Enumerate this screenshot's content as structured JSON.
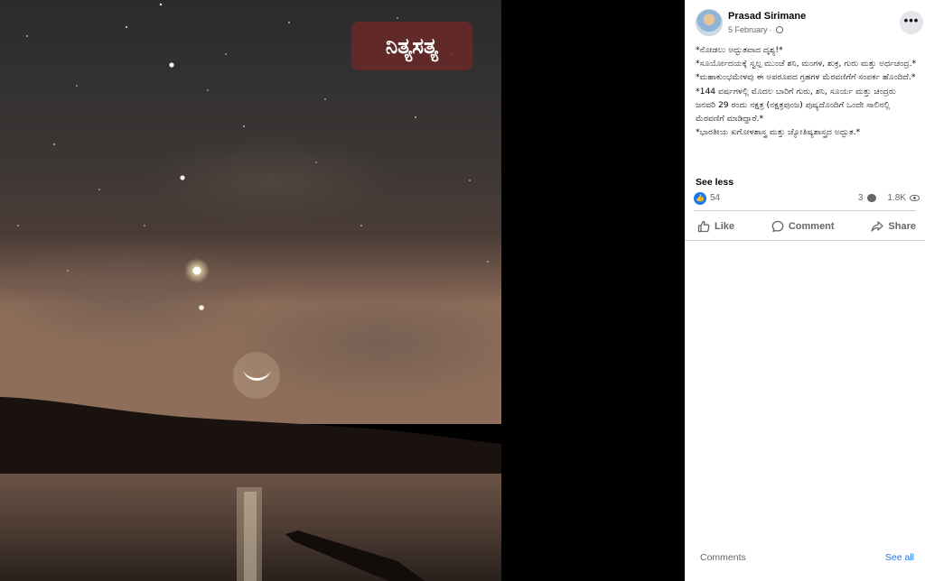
{
  "photo": {
    "watermark": "ನಿತ್ಯಸತ್ಯ"
  },
  "post": {
    "author": "Prasad Sirimane",
    "date": "5 February",
    "caption_lines": [
      "*ನೋಡಲು ಅದ್ಭುತವಾದ ದೃಶ್ಯ!*",
      "*ಸೂರ್ಯೋದಯಕ್ಕೆ ಸ್ವಲ್ಪ ಮುಂಚೆ ಶನಿ, ಮಂಗಳ, ಶುಕ್ರ, ಗುರು ಮತ್ತು ಅರ್ಧಚಂದ್ರ.*",
      "*ಮಹಾಕುಂಭಮೇಳವು ಈ ಅಪರೂಪದ ಗ್ರಹಗಳ ಮೆರವಣಿಗೆಗೆ ಸಂಪರ್ಕ ಹೊಂದಿದೆ.* *144 ವರ್ಷಗಳಲ್ಲಿ ಮೊದಲ ಬಾರಿಗೆ ಗುರು, ಶನಿ, ಸೂರ್ಯ ಮತ್ತು ಚಂದ್ರರು ಜನವರಿ 29 ರಂದು ನಕ್ಷತ್ರ (ನಕ್ಷತ್ರಪುಂಜ) ಪುಷ್ಯದೊಂದಿಗೆ ಒಂದೇ ಸಾಲಿನಲ್ಲಿ ಮೆರವಣಿಗೆ ಮಾಡಿದ್ದಾರೆ.*",
      "*ಭಾರತೀಯ ಖಗೋಳಶಾಸ್ತ್ರ ಮತ್ತು ಜ್ಯೋತಿಷ್ಯಶಾಸ್ತ್ರದ ಅದ್ಭುತ.*"
    ],
    "see_less": "See less",
    "reaction_count": "54",
    "comment_count": "3",
    "view_count": "1.8K",
    "more_label": "•••"
  },
  "actions": {
    "like": "Like",
    "comment": "Comment",
    "share": "Share"
  },
  "comments": {
    "label": "Comments",
    "see_all": "See all"
  },
  "colors": {
    "accent": "#1877f2",
    "muted": "#65676b"
  },
  "icons": [
    "avatar",
    "globe-icon",
    "more-icon",
    "like-reaction-icon",
    "comment-count-icon",
    "views-eye-icon",
    "like-icon",
    "comment-icon",
    "share-icon"
  ]
}
